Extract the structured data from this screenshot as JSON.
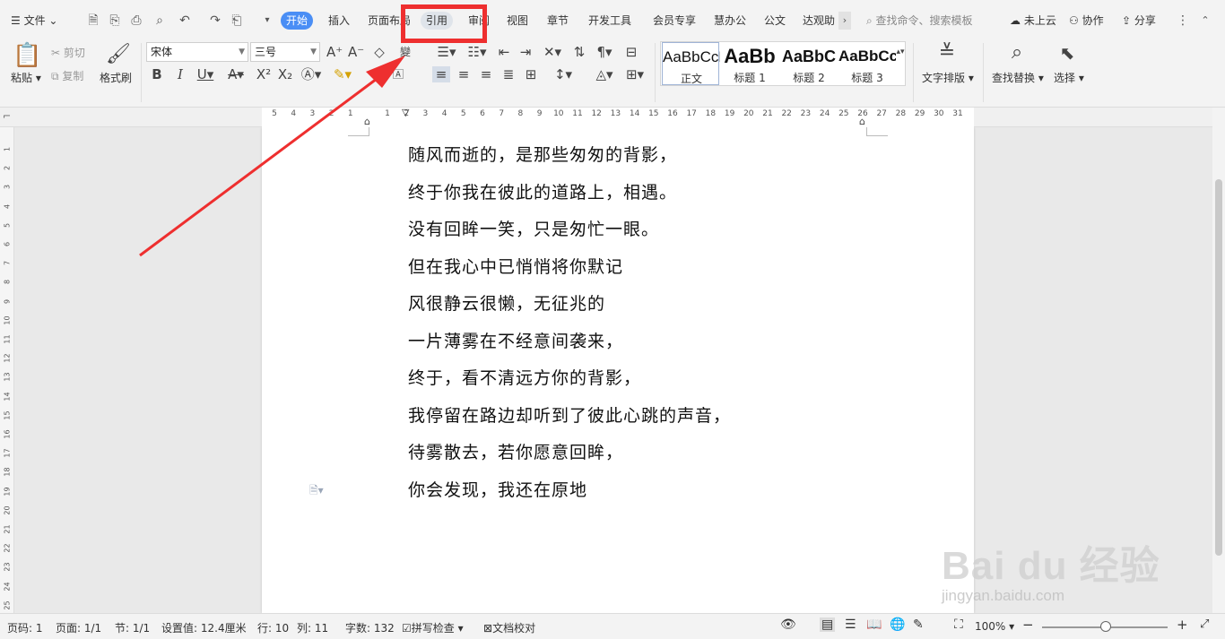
{
  "menubar": {
    "file_label": "文件",
    "tabs": [
      "开始",
      "插入",
      "页面布局",
      "引用",
      "审阅",
      "视图",
      "章节",
      "开发工具",
      "会员专享",
      "慧办公",
      "公文",
      "达观助"
    ],
    "search_placeholder": "查找命令、搜索模板",
    "cloud_label": "未上云",
    "collab_label": "协作",
    "share_label": "分享"
  },
  "ribbon": {
    "paste": "粘贴",
    "cut": "剪切",
    "copy": "复制",
    "format_painter": "格式刷",
    "font_name": "宋体",
    "font_size": "三号",
    "styles": [
      {
        "sample": "AaBbCcDd",
        "label": "正文"
      },
      {
        "sample": "AaBb",
        "label": "标题 1"
      },
      {
        "sample": "AaBbC",
        "label": "标题 2"
      },
      {
        "sample": "AaBbCc",
        "label": "标题 3"
      }
    ],
    "text_layout": "文字排版",
    "find_replace": "查找替换",
    "select": "选择"
  },
  "ruler": {
    "h_left": [
      "5",
      "4",
      "3",
      "2",
      "1"
    ],
    "h_right": [
      "1",
      "2",
      "3",
      "4",
      "5",
      "6",
      "7",
      "8",
      "9",
      "10",
      "11",
      "12",
      "13",
      "14",
      "15",
      "16",
      "17",
      "18",
      "19",
      "20",
      "21",
      "22",
      "23",
      "24",
      "25",
      "26",
      "27",
      "28",
      "29",
      "30",
      "31"
    ],
    "v": [
      "1",
      "2",
      "3",
      "4",
      "5",
      "6",
      "7",
      "8",
      "9",
      "10",
      "11",
      "12",
      "13",
      "14",
      "15",
      "16",
      "17",
      "18",
      "19",
      "20",
      "21",
      "22",
      "23",
      "24",
      "25"
    ]
  },
  "document": {
    "lines": [
      "随风而逝的，是那些匆匆的背影，",
      "终于你我在彼此的道路上，相遇。",
      "没有回眸一笑，只是匆忙一眼。",
      "但在我心中已悄悄将你默记",
      "风很静云很懒，无征兆的",
      "一片薄雾在不经意间袭来，",
      "终于，看不清远方你的背影，",
      "我停留在路边却听到了彼此心跳的声音，",
      "待雾散去，若你愿意回眸，",
      "你会发现，我还在原地"
    ]
  },
  "status": {
    "page_no": "页码: 1",
    "page": "页面: 1/1",
    "section": "节: 1/1",
    "setting": "设置值: 12.4厘米",
    "row": "行: 10",
    "col": "列: 11",
    "words": "字数: 132",
    "spell": "拼写检查",
    "proof": "文档校对",
    "zoom": "100%"
  },
  "watermark": {
    "brand": "Bai du 经验",
    "url": "jingyan.baidu.com"
  },
  "colors": {
    "active_tab": "#4a8ef5",
    "annotation": "#ee2f2f"
  }
}
